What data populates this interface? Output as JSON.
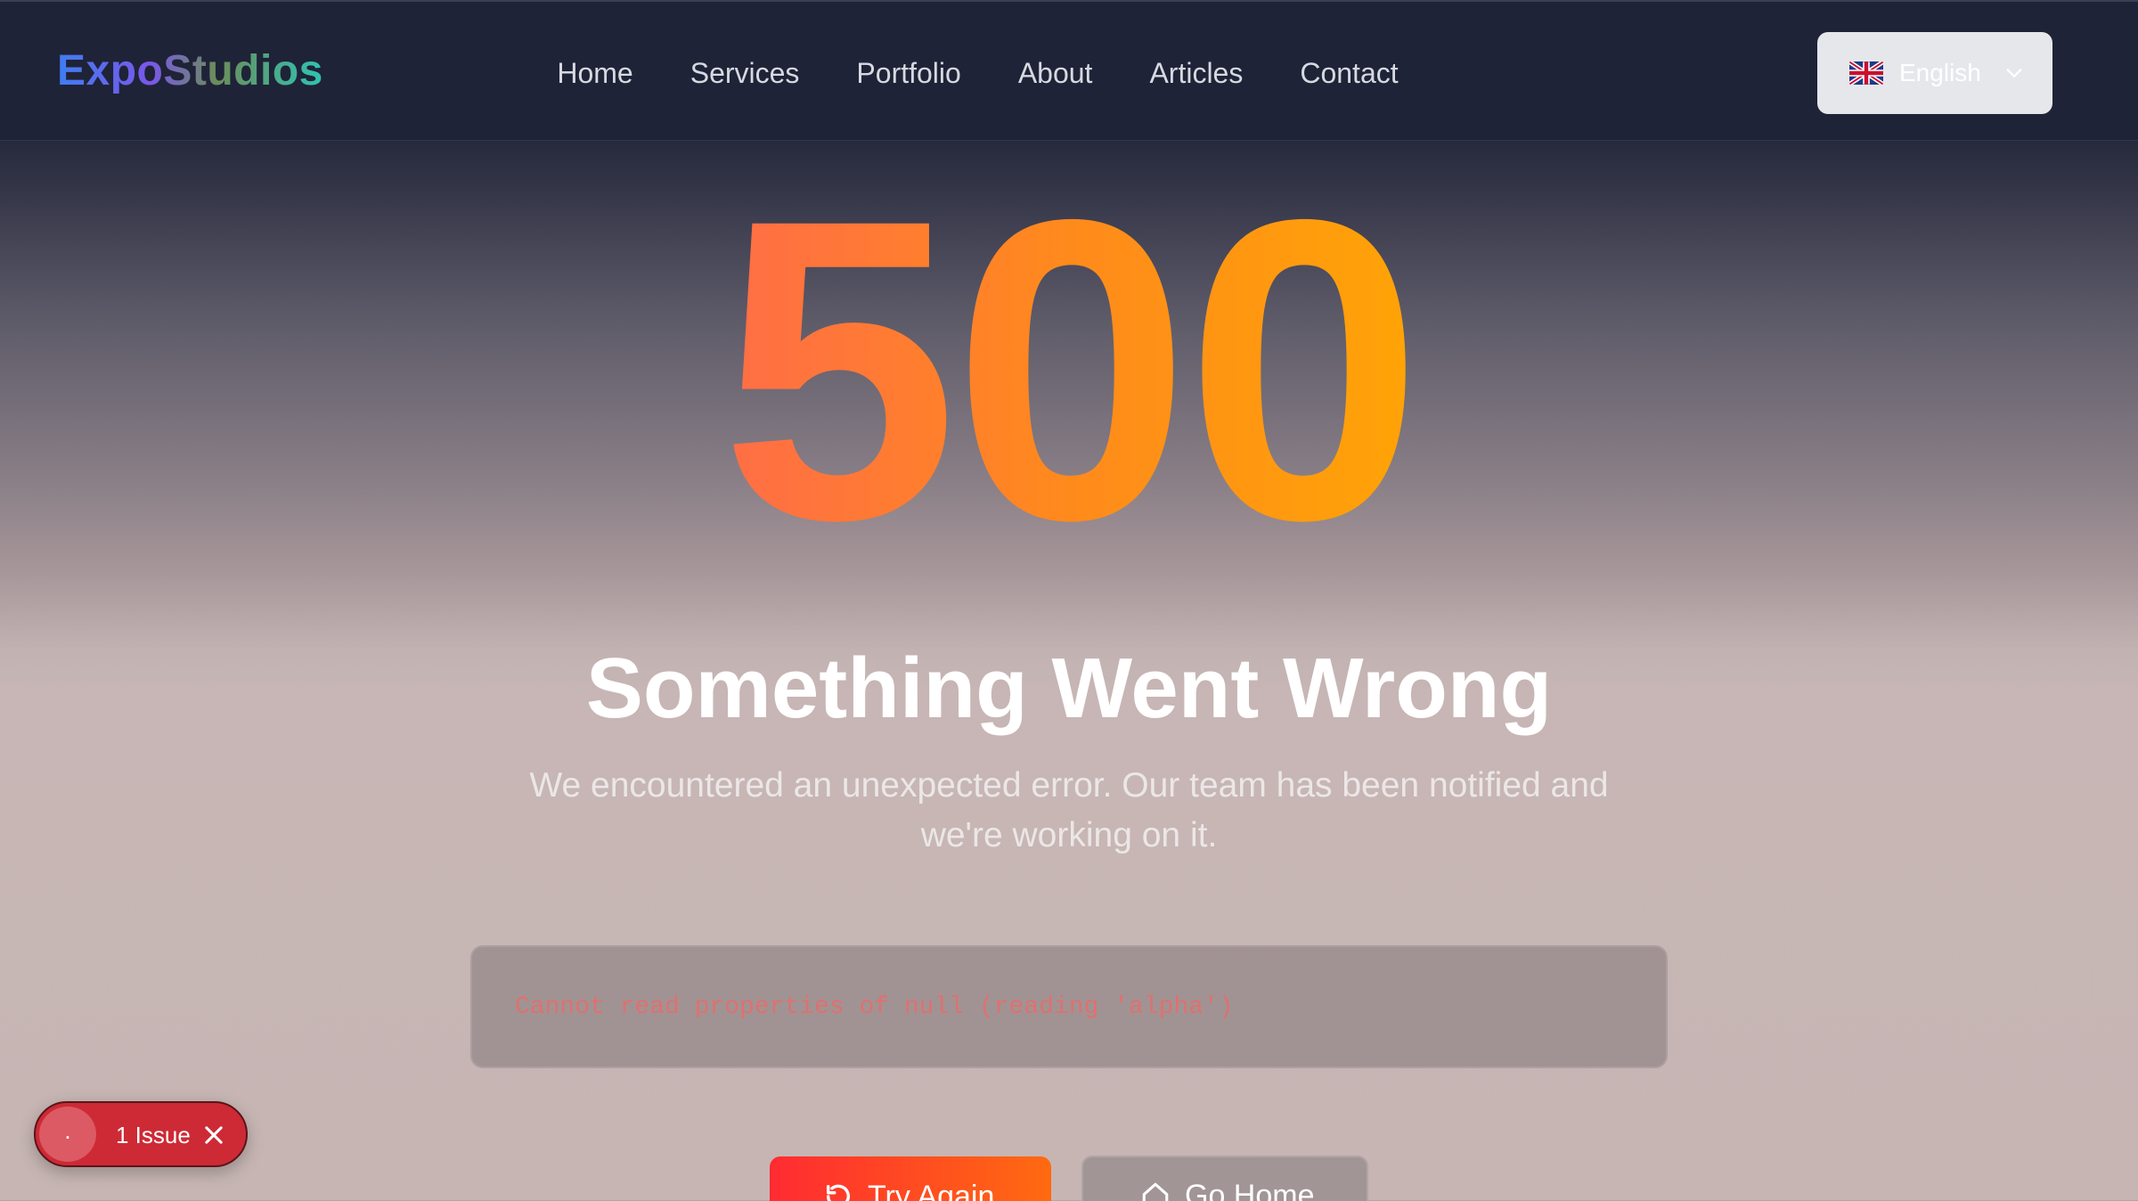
{
  "header": {
    "logo": "ExpoStudios",
    "nav": [
      "Home",
      "Services",
      "Portfolio",
      "About",
      "Articles",
      "Contact"
    ],
    "language": {
      "label": "English",
      "flag_icon": "uk-flag-icon"
    }
  },
  "main": {
    "code": "500",
    "title": "Something Went Wrong",
    "subtitle_line1": "We encountered an unexpected error. Our team has been notified and",
    "subtitle_line2": "we're working on it.",
    "error_message": "Cannot read properties of null (reading 'alpha')",
    "primary_button": {
      "icon": "refresh-icon",
      "label": "Try Again"
    },
    "secondary_button": {
      "icon": "home-icon",
      "label": "Go Home"
    }
  },
  "issues": {
    "dot": ".",
    "label": "1 Issue",
    "close_icon": "close-icon"
  },
  "colors": {
    "header_bg": "#1f2337",
    "accent_orange": "#ff8a1c",
    "error_red": "#e07070",
    "issue_red": "#cd2a35"
  }
}
